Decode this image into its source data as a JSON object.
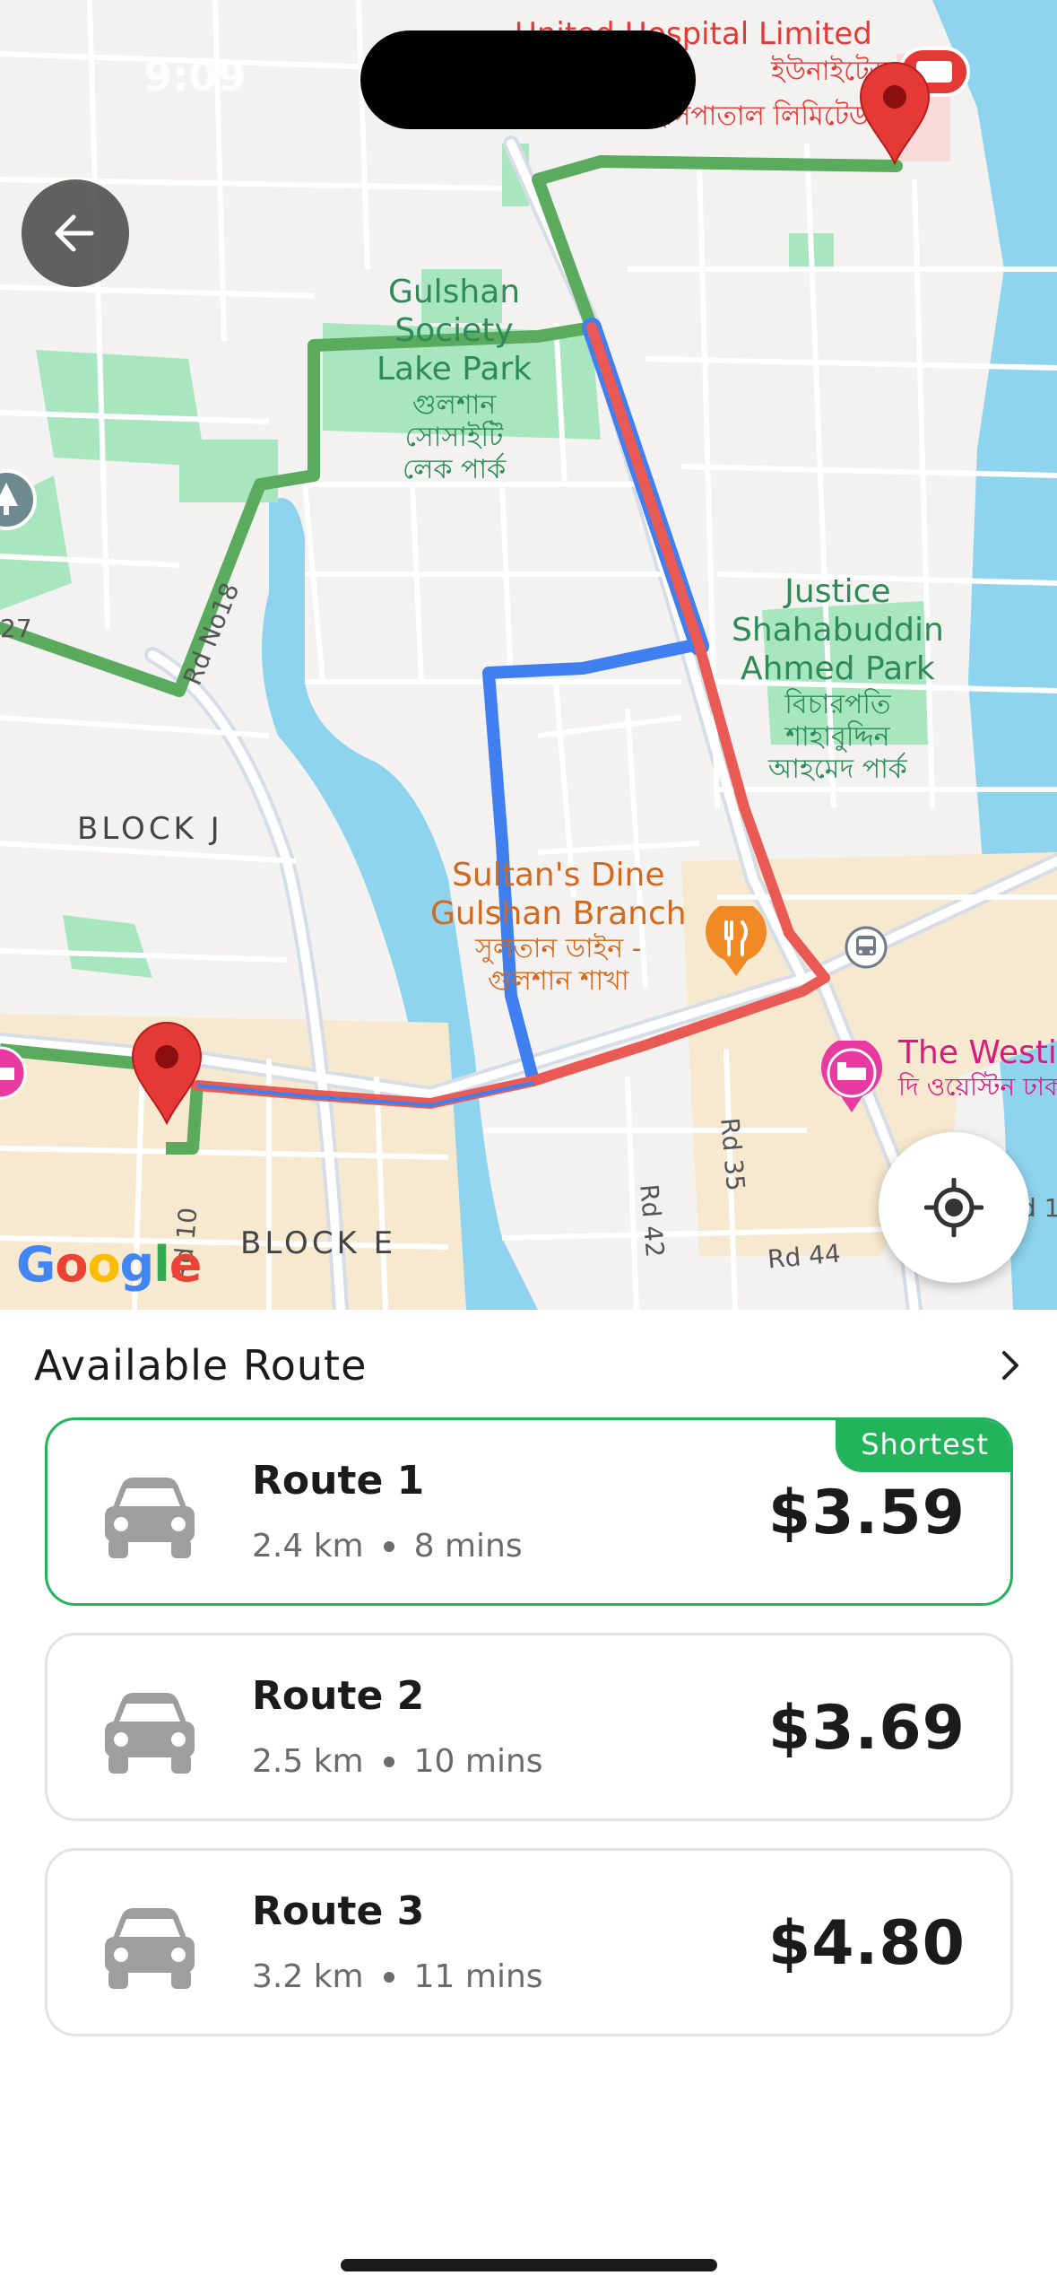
{
  "status_bar": {
    "time": "9:09"
  },
  "map": {
    "labels": {
      "hospital_en": "United Hospital Limited",
      "hospital_bn_1": "ইউনাইটেড",
      "hospital_bn_2": "হাসপাতাল লিমিটেড",
      "gulshan_park_en_1": "Gulshan",
      "gulshan_park_en_2": "Society",
      "gulshan_park_en_3": "Lake Park",
      "gulshan_park_bn_1": "গুলশান",
      "gulshan_park_bn_2": "সোসাইটি",
      "gulshan_park_bn_3": "লেক পার্ক",
      "justice_park_en_1": "Justice",
      "justice_park_en_2": "Shahabuddin",
      "justice_park_en_3": "Ahmed Park",
      "justice_park_bn_1": "বিচারপতি",
      "justice_park_bn_2": "শাহাবুদ্দিন",
      "justice_park_bn_3": "আহমেদ পার্ক",
      "restaurant_en_1": "Sultan's Dine",
      "restaurant_en_2": "Gulshan Branch",
      "restaurant_bn_1": "সুলতান ডাইন -",
      "restaurant_bn_2": "গুলশান শাখা",
      "hotel_en": "The Westin",
      "hotel_bn": "দি ওয়েস্টিন ঢাকা",
      "block_j": "BLOCK J",
      "block_e": "BLOCK E",
      "rd_no18": "Rd No18",
      "rd_10": "Rd 10",
      "rd_35": "Rd 35",
      "rd_42": "Rd 42",
      "rd_44": "Rd 44",
      "rd_27": "27",
      "rd_1_partial": "d 1"
    },
    "google_logo": [
      "G",
      "o",
      "o",
      "g",
      "l",
      "e"
    ],
    "google_colors": [
      "#4285F4",
      "#EA4335",
      "#FBBC05",
      "#4285F4",
      "#34A853",
      "#EA4335"
    ],
    "route_colors": {
      "green": "#5aab5e",
      "blue": "#3f7ff0",
      "red": "#ea5a55"
    }
  },
  "sheet": {
    "title": "Available Route",
    "routes": [
      {
        "name": "Route 1",
        "distance": "2.4 km",
        "duration": "8 mins",
        "price": "$3.59",
        "badge": "Shortest",
        "selected": true
      },
      {
        "name": "Route 2",
        "distance": "2.5 km",
        "duration": "10 mins",
        "price": "$3.69",
        "badge": "",
        "selected": false
      },
      {
        "name": "Route 3",
        "distance": "3.2 km",
        "duration": "11 mins",
        "price": "$4.80",
        "badge": "",
        "selected": false
      }
    ]
  },
  "icons": {
    "back": "arrow-left-icon",
    "locate": "my-location-icon",
    "chevron": "chevron-right-icon",
    "car": "car-icon",
    "pin": "map-pin-icon",
    "hotel": "bed-icon",
    "restaurant": "fork-knife-icon",
    "bus": "bus-icon"
  },
  "colors": {
    "accent": "#22b45a",
    "pin": "#e53935",
    "card_border": "#e3e3e3"
  }
}
